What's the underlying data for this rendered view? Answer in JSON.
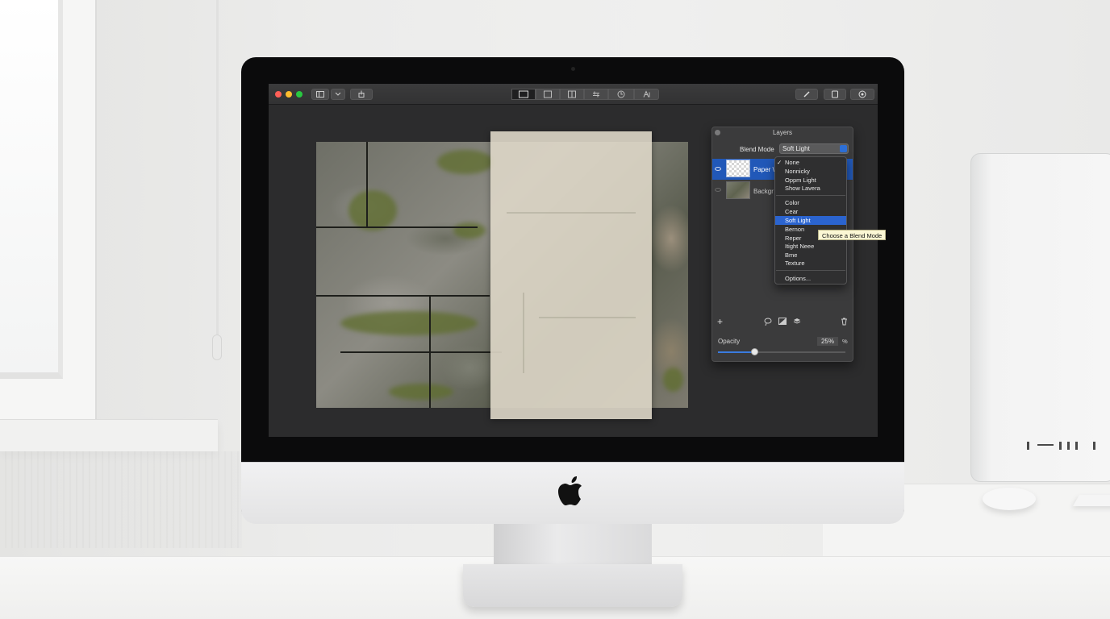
{
  "titlebar": {
    "traffic_colors": [
      "#ff5f57",
      "#febc2e",
      "#28c840"
    ],
    "left_icons": [
      "sidebar-icon",
      "chevron-down-icon",
      "share-icon"
    ],
    "center_tools": [
      "select-icon",
      "crop-icon",
      "split-icon",
      "adjust-icon",
      "history-icon",
      "text-icon"
    ],
    "right_icons": [
      "brush-icon",
      "layers-icon",
      "info-icon"
    ]
  },
  "layers_panel": {
    "title": "Layers",
    "blend_mode_label": "Blend Mode",
    "blend_mode_value": "Soft Light",
    "layers": [
      {
        "name": "Paper",
        "suffix": "\\",
        "selected": true,
        "visible": true
      },
      {
        "name": "Backgr",
        "selected": false,
        "visible": false
      }
    ],
    "blend_menu": {
      "group1": [
        "None",
        "Nonnicky",
        "Oppm Light",
        "Show Lavera"
      ],
      "group2": [
        "Color",
        "Cear",
        "Soft Light",
        "Bernon",
        "Reper",
        "Itight Neee",
        "Bme",
        "Texture"
      ],
      "footer": "Options...",
      "checked_item": "None",
      "highlighted_item": "Soft Light",
      "tooltip": "Choose a Blend Mode"
    },
    "bottom_tools": [
      "add-layer-icon",
      "lasso-icon",
      "mask-icon",
      "stack-icon",
      "trash-icon"
    ],
    "add_glyph": "+",
    "opacity": {
      "label": "Opacity",
      "value": "25%",
      "unit": "%",
      "fraction": 0.25
    }
  }
}
